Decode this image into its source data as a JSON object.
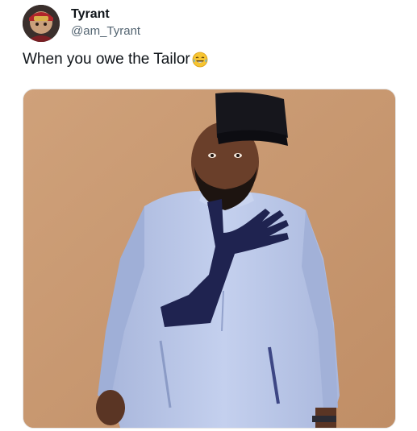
{
  "post": {
    "author_name": "Tyrant",
    "author_handle": "@am_Tyrant",
    "text": "When you owe the Tailor",
    "emoji": "laughing-tears-emoji"
  },
  "colors": {
    "name_text": "#0f1419",
    "handle_text": "#536471",
    "photo_background": "#c99a72",
    "garment": "#b9c6e6",
    "garment_accent": "#1f2350",
    "cap": "#16161c"
  }
}
